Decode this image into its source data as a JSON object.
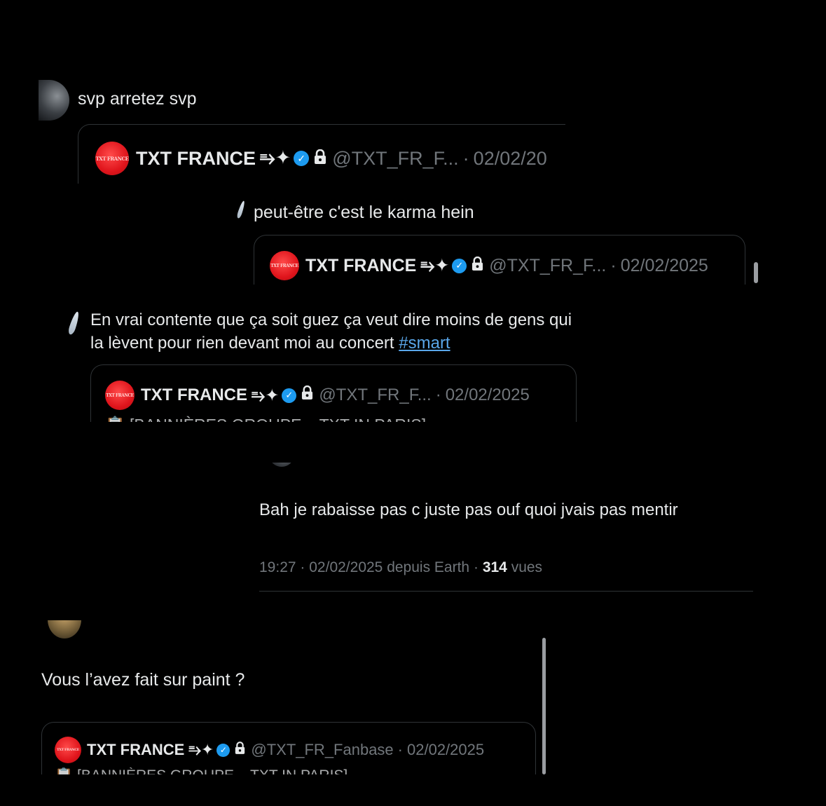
{
  "quoted_account": {
    "name": "TXT FRANCE",
    "decoration": "⥱✦",
    "logo_text": "TXT FRANCE",
    "handle_short": "@TXT_FR_F...",
    "handle_full": "@TXT_FR_Fanbase",
    "date": "02/02/2025",
    "date_clipped": "02/02/20",
    "quoted_preview": "📋 [BANNIÈRES GROUPE – TXT IN PARIS]",
    "icons": [
      "verified-badge-icon",
      "lock-icon"
    ]
  },
  "posts": [
    {
      "id": "p1",
      "text": "svp arretez svp"
    },
    {
      "id": "p2",
      "text": "peut-être c'est le karma hein"
    },
    {
      "id": "p3",
      "text_before": "En vrai contente que ça soit guez ça veut dire moins de gens qui la lèvent pour rien devant moi au concert ",
      "hashtag": "#smart"
    },
    {
      "id": "p4",
      "text": "Bah je rabaisse pas c juste pas ouf quoi jvais pas mentir",
      "meta_time": "19:27",
      "meta_date": "02/02/2025",
      "meta_source": "depuis Earth",
      "views_count": "314",
      "views_label": "vues"
    },
    {
      "id": "p5",
      "text": "Vous l’avez fait sur paint ?"
    }
  ],
  "colors": {
    "background": "#000000",
    "text": "#e7e9ea",
    "muted": "#71767b",
    "border": "#2f3336",
    "link": "#5aa7ea",
    "verified": "#1d9bf0",
    "logo_red": "#e0151c"
  },
  "separator_dot": "·"
}
